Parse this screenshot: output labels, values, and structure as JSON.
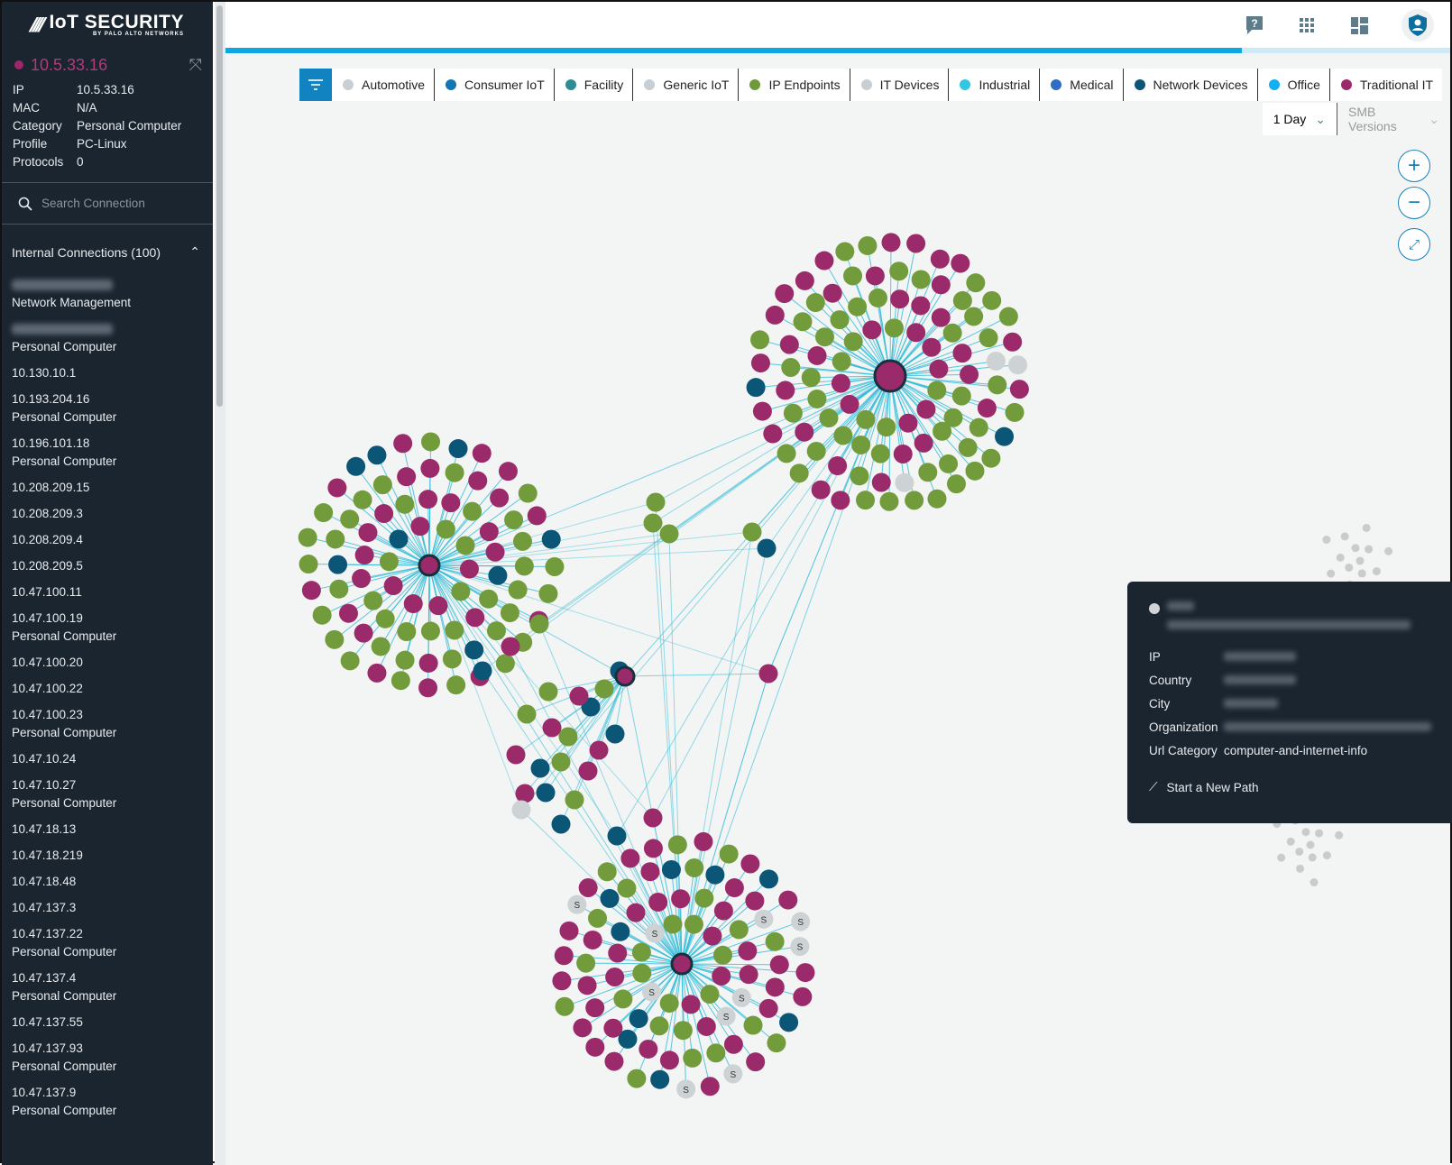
{
  "brand": {
    "title": "IoT SECURITY",
    "subtitle": "BY PALO ALTO NETWORKS"
  },
  "device": {
    "name": "10.5.33.16",
    "color": "#a0256c",
    "props": [
      {
        "k": "IP",
        "v": "10.5.33.16"
      },
      {
        "k": "MAC",
        "v": "N/A"
      },
      {
        "k": "Category",
        "v": "Personal Computer"
      },
      {
        "k": "Profile",
        "v": "PC-Linux"
      },
      {
        "k": "Protocols",
        "v": "0"
      }
    ]
  },
  "search": {
    "placeholder": "Search Connection"
  },
  "connections": {
    "title": "Internal Connections (100)",
    "items": [
      {
        "ip": "",
        "sub": "Network Management",
        "blurred": true
      },
      {
        "ip": "",
        "sub": "Personal Computer",
        "blurred": true
      },
      {
        "ip": "10.130.10.1",
        "sub": ""
      },
      {
        "ip": "10.193.204.16",
        "sub": "Personal Computer"
      },
      {
        "ip": "10.196.101.18",
        "sub": "Personal Computer"
      },
      {
        "ip": "10.208.209.15",
        "sub": ""
      },
      {
        "ip": "10.208.209.3",
        "sub": ""
      },
      {
        "ip": "10.208.209.4",
        "sub": ""
      },
      {
        "ip": "10.208.209.5",
        "sub": ""
      },
      {
        "ip": "10.47.100.11",
        "sub": ""
      },
      {
        "ip": "10.47.100.19",
        "sub": "Personal Computer"
      },
      {
        "ip": "10.47.100.20",
        "sub": ""
      },
      {
        "ip": "10.47.100.22",
        "sub": ""
      },
      {
        "ip": "10.47.100.23",
        "sub": "Personal Computer"
      },
      {
        "ip": "10.47.10.24",
        "sub": ""
      },
      {
        "ip": "10.47.10.27",
        "sub": "Personal Computer"
      },
      {
        "ip": "10.47.18.13",
        "sub": ""
      },
      {
        "ip": "10.47.18.219",
        "sub": ""
      },
      {
        "ip": "10.47.18.48",
        "sub": ""
      },
      {
        "ip": "10.47.137.3",
        "sub": ""
      },
      {
        "ip": "10.47.137.22",
        "sub": "Personal Computer"
      },
      {
        "ip": "10.47.137.4",
        "sub": "Personal Computer"
      },
      {
        "ip": "10.47.137.55",
        "sub": ""
      },
      {
        "ip": "10.47.137.93",
        "sub": "Personal Computer"
      },
      {
        "ip": "10.47.137.9",
        "sub": "Personal Computer"
      }
    ]
  },
  "progress": 0.83,
  "legend": [
    {
      "label": "Automotive",
      "color": "#c8cfd4"
    },
    {
      "label": "Consumer IoT",
      "color": "#1476b3"
    },
    {
      "label": "Facility",
      "color": "#2e8c93"
    },
    {
      "label": "Generic IoT",
      "color": "#c8cfd4"
    },
    {
      "label": "IP Endpoints",
      "color": "#6f9a3a"
    },
    {
      "label": "IT Devices",
      "color": "#c8cfd4"
    },
    {
      "label": "Industrial",
      "color": "#30c8e0"
    },
    {
      "label": "Medical",
      "color": "#2e6cc6"
    },
    {
      "label": "Network Devices",
      "color": "#0b5577"
    },
    {
      "label": "Office",
      "color": "#12b0f2"
    },
    {
      "label": "Traditional IT",
      "color": "#9b2a6a"
    }
  ],
  "filters": {
    "time": "1 Day",
    "smb": "SMB Versions"
  },
  "node_badge": "S",
  "tooltip": {
    "fields": [
      {
        "k": "IP"
      },
      {
        "k": "Country"
      },
      {
        "k": "City"
      },
      {
        "k": "Organization"
      },
      {
        "k": "Url Category",
        "v": "computer-and-internet-info"
      }
    ],
    "action": "Start a New Path"
  },
  "colors": {
    "green": "#729c3c",
    "magenta": "#9b2a6a",
    "navy": "#0b5577",
    "gray": "#cdd2d5",
    "edge": "#2fbcd8"
  }
}
